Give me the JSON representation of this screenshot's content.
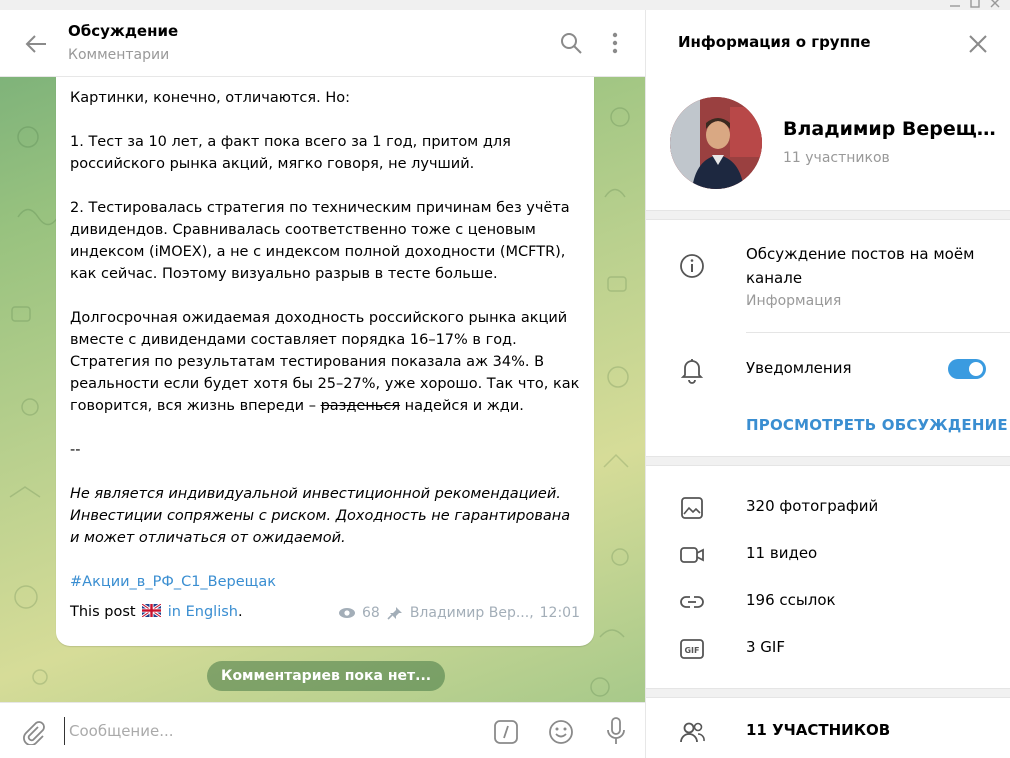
{
  "chat": {
    "title": "Обсуждение",
    "subtitle": "Комментарии",
    "message": {
      "line1": "Картинки, конечно, отличаются. Но:",
      "para1": "1. Тест за 10 лет, а факт пока всего за 1 год, притом для\nроссийского рынка акций, мягко говоря, не лучший.",
      "para2": "2. Тестировалась стратегия по техническим причинам без учёта\nдивидендов. Сравнивалась соответственно тоже с ценовым\nиндексом (iMOEX), а не с индексом полной доходности (MCFTR),\nкак сейчас. Поэтому визуально разрыв в тесте больше.",
      "para3_start": "Долгосрочная ожидаемая доходность российского рынка акций\nвместе с дивидендами составляет порядка 16–17% в год.\nСтратегия по результатам тестирования показала аж 34%. В\nреальности если будет хотя бы 25–27%, уже хорошо. Так что, как\nговорится, вся жизнь впереди – ",
      "para3_strike": "разденься",
      "para3_end": " надейся и жди.",
      "dashes": "--",
      "disclaimer": "Не является индивидуальной инвестиционной рекомендацией.\nИнвестиции сопряжены с риском. Доходность не гарантирована\nи может отличаться от ожидаемой.",
      "hashtag": "#Акции_в_РФ_С1_Верещак",
      "post_prefix": "This post",
      "post_link": "in English",
      "post_suffix": ".",
      "views": "68",
      "author": "Владимир Вер...,",
      "time": "12:01"
    },
    "no_comments": "Комментариев пока нет...",
    "composer_placeholder": "Сообщение..."
  },
  "info": {
    "title": "Информация о группе",
    "group_name": "Владимир Верещ...",
    "group_count": "11 участников",
    "about_text": "Обсуждение постов на моём канале",
    "about_label": "Информация",
    "notifications_label": "Уведомления",
    "notifications_on": true,
    "view_discussion": "ПРОСМОТРЕТЬ ОБСУЖДЕНИЕ",
    "media": [
      {
        "label": "320 фотографий",
        "icon": "photo-icon"
      },
      {
        "label": "11 видео",
        "icon": "video-icon"
      },
      {
        "label": "196 ссылок",
        "icon": "link-icon"
      },
      {
        "label": "3 GIF",
        "icon": "gif-icon"
      }
    ],
    "members_label": "11 УЧАСТНИКОВ"
  },
  "colors": {
    "accent": "#3a8ed1",
    "toggle": "#3a9be0",
    "muted": "#999999"
  }
}
